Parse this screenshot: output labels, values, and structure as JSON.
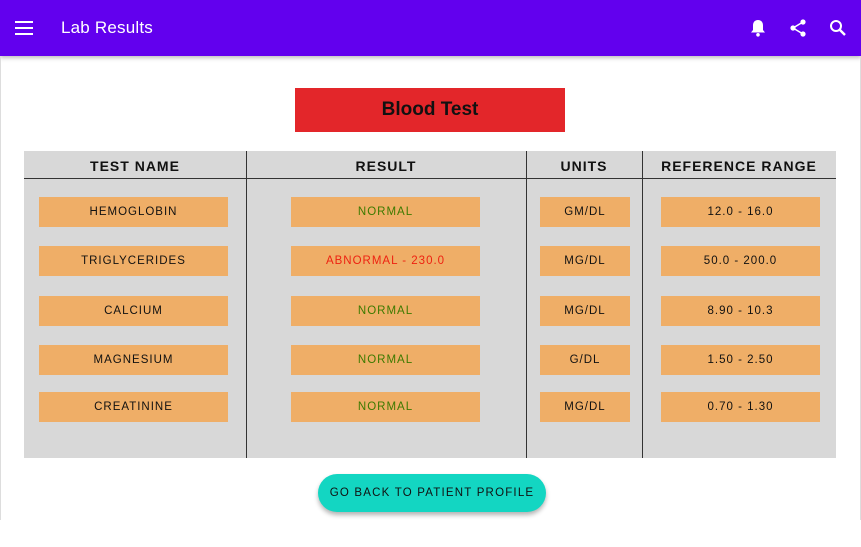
{
  "app_bar": {
    "title": "Lab Results",
    "background": "#6200ee",
    "icons": [
      "menu-icon",
      "bell-icon",
      "share-icon",
      "search-icon"
    ]
  },
  "banner": {
    "title": "Blood Test",
    "background": "#e3262a"
  },
  "table": {
    "headers": [
      "TEST NAME",
      "RESULT",
      "UNITS",
      "REFERENCE RANGE"
    ],
    "rows": [
      {
        "test": "HEMOGLOBIN",
        "result": "NORMAL",
        "status": "normal",
        "units": "GM/DL",
        "range": "12.0 - 16.0"
      },
      {
        "test": "TRIGLYCERIDES",
        "result": "ABNORMAL - 230.0",
        "status": "abnormal",
        "units": "MG/DL",
        "range": "50.0 - 200.0"
      },
      {
        "test": "CALCIUM",
        "result": "NORMAL",
        "status": "normal",
        "units": "MG/DL",
        "range": "8.90 - 10.3"
      },
      {
        "test": "MAGNESIUM",
        "result": "NORMAL",
        "status": "normal",
        "units": "G/DL",
        "range": "1.50 - 2.50"
      },
      {
        "test": "CREATININE",
        "result": "NORMAL",
        "status": "normal",
        "units": "MG/DL",
        "range": "0.70 - 1.30"
      }
    ],
    "colors": {
      "cell": "#efae67",
      "normal_text": "#3d7a00",
      "abnormal_text": "#ee2211",
      "background": "#d8d8d8"
    }
  },
  "actions": {
    "back_label": "GO BACK TO PATIENT PROFILE",
    "back_color": "#13d6c2"
  }
}
